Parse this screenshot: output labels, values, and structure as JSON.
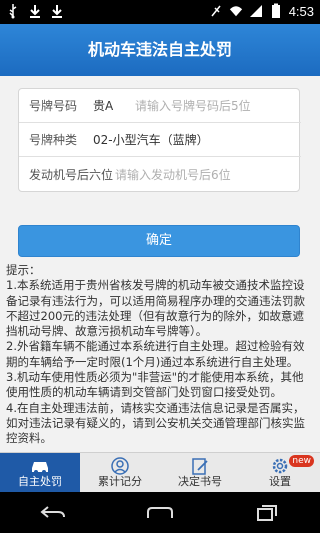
{
  "status_bar": {
    "time": "4:53",
    "icons": [
      "usb-icon",
      "download-icon",
      "download-icon",
      "no-signal-icon",
      "wifi-icon",
      "cell-signal-icon",
      "battery-icon"
    ]
  },
  "header": {
    "title": "机动车违法自主处罚"
  },
  "form": {
    "plate_number": {
      "label": "号牌号码",
      "prefix": "贵A",
      "placeholder": "请输入号牌号码后5位"
    },
    "plate_type": {
      "label": "号牌种类",
      "value": "02-小型汽车（蓝牌）"
    },
    "engine": {
      "label": "发动机号后六位",
      "placeholder": "请输入发动机号后6位"
    }
  },
  "confirm_label": "确定",
  "tips": {
    "title": "提示：",
    "lines": [
      "1.本系统适用于贵州省核发号牌的机动车被交通技术监控设备记录有违法行为，可以适用简易程序办理的交通违法罚款不超过200元的违法处理（但有故意行为的除外，如故意遮挡机动号牌、故意污损机动车号牌等）。",
      "2.外省籍车辆不能通过本系统进行自主处理。超过检验有效期的车辆给予一定时限(1个月)通过本系统进行自主处理。",
      "3.机动车使用性质必须为\"非营运\"的才能使用本系统，其他使用性质的机动车辆请到交管部门处罚窗口接受处罚。",
      "4.在自主处理违法前，请核实交通违法信息记录是否属实，如对违法记录有疑义的，请到公安机关交通管理部门核实监控资料。"
    ]
  },
  "tabs": [
    {
      "label": "自主处罚",
      "icon": "car-icon",
      "active": true
    },
    {
      "label": "累计记分",
      "icon": "user-icon",
      "active": false
    },
    {
      "label": "决定书号",
      "icon": "edit-document-icon",
      "active": false
    },
    {
      "label": "设置",
      "icon": "gear-icon",
      "active": false,
      "badge": "new"
    }
  ],
  "nav": [
    "back-icon",
    "home-icon",
    "recents-icon"
  ],
  "colors": {
    "header": "#1c6bc0",
    "confirm": "#3a95e0",
    "active_tab": "#1f5aa7",
    "badge": "#d9351f"
  }
}
